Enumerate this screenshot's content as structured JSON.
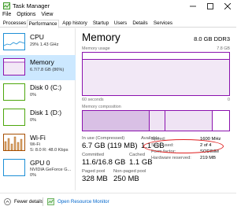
{
  "window": {
    "title": "Task Manager"
  },
  "menu": [
    "File",
    "Options",
    "View"
  ],
  "tabs": [
    "Processes",
    "Performance",
    "App history",
    "Startup",
    "Users",
    "Details",
    "Services"
  ],
  "active_tab": "Performance",
  "sidebar": {
    "items": [
      {
        "title": "CPU",
        "sub1": "29% 1.43 GHz",
        "sub2": "",
        "color": "#1e8fd6"
      },
      {
        "title": "Memory",
        "sub1": "6.7/7.8 GB (86%)",
        "sub2": "",
        "color": "#8b12ae",
        "selected": true
      },
      {
        "title": "Disk 0 (C:)",
        "sub1": "0%",
        "sub2": "",
        "color": "#4da60c"
      },
      {
        "title": "Disk 1 (D:)",
        "sub1": "0%",
        "sub2": "",
        "color": "#4da60c"
      },
      {
        "title": "Wi-Fi",
        "sub1": "Wi-Fi",
        "sub2": "S: 8.0 R: 48.0 Kbps",
        "color": "#a74f01"
      },
      {
        "title": "GPU 0",
        "sub1": "NVIDIA GeForce G...",
        "sub2": "0%",
        "color": "#1e8fd6"
      }
    ]
  },
  "main": {
    "title": "Memory",
    "capacity": "8.0 GB DDR3",
    "usage_label": "Memory usage",
    "usage_max": "7.8 GB",
    "usage_fraction": 0.86,
    "time_label": "60 seconds",
    "zero_label": "0",
    "composition_label": "Memory composition",
    "stats": {
      "in_use_label": "In use (Compressed)",
      "in_use_value": "6.7 GB (119 MB)",
      "available_label": "Available",
      "available_value": "1.1 GB",
      "committed_label": "Committed",
      "committed_value": "11.6/16.8 GB",
      "cached_label": "Cached",
      "cached_value": "1.1 GB",
      "paged_label": "Paged pool",
      "paged_value": "328 MB",
      "nonpaged_label": "Non-paged pool",
      "nonpaged_value": "250 MB"
    },
    "right_stats": [
      {
        "label": "Speed:",
        "value": "1600 MHz"
      },
      {
        "label": "Slots used:",
        "value": "2 of 4"
      },
      {
        "label": "Form factor:",
        "value": "SODIMM"
      },
      {
        "label": "Hardware reserved:",
        "value": "219 MB"
      }
    ],
    "annotation_color": "#e02020"
  },
  "footer": {
    "fewer_details": "Fewer details",
    "resource_monitor": "Open Resource Monitor"
  }
}
